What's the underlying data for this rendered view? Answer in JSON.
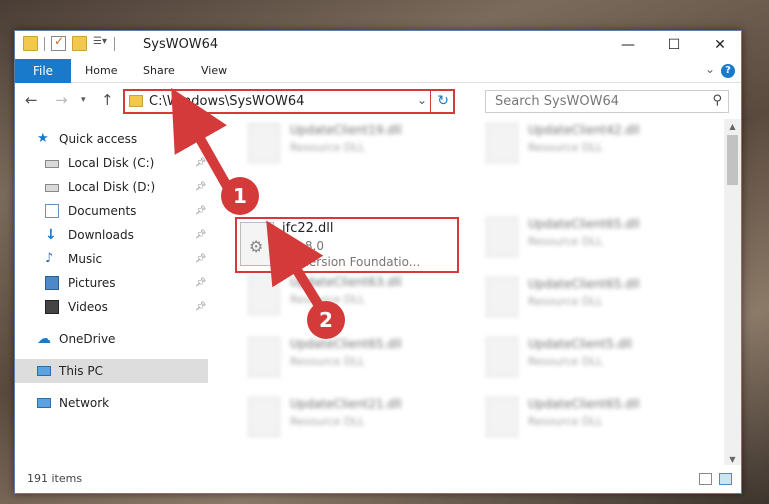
{
  "window": {
    "title": "SysWOW64",
    "minimize": "—",
    "maximize": "☐",
    "close": "✕"
  },
  "ribbon": {
    "file_label": "File",
    "tabs": [
      "Home",
      "Share",
      "View"
    ],
    "help": "?"
  },
  "navigation": {
    "back_icon": "back-arrow-icon",
    "forward_icon": "forward-arrow-icon",
    "recent_icon": "chevron-down-icon",
    "up_icon": "up-arrow-icon",
    "address_path": "C:\\Windows\\SysWOW64",
    "search_placeholder": "Search SysWOW64"
  },
  "sidebar": {
    "items": [
      {
        "label": "Quick access",
        "icon": "star-icon",
        "pinned": false
      },
      {
        "label": "Local Disk (C:)",
        "icon": "drive-icon",
        "pinned": true
      },
      {
        "label": "Local Disk (D:)",
        "icon": "drive-icon",
        "pinned": true
      },
      {
        "label": "Documents",
        "icon": "documents-icon",
        "pinned": true
      },
      {
        "label": "Downloads",
        "icon": "download-icon",
        "pinned": true
      },
      {
        "label": "Music",
        "icon": "music-icon",
        "pinned": true
      },
      {
        "label": "Pictures",
        "icon": "pictures-icon",
        "pinned": true
      },
      {
        "label": "Videos",
        "icon": "videos-icon",
        "pinned": true
      },
      {
        "label": "OneDrive",
        "icon": "cloud-icon",
        "pinned": false
      },
      {
        "label": "This PC",
        "icon": "computer-icon",
        "pinned": false,
        "selected": true
      },
      {
        "label": "Network",
        "icon": "network-icon",
        "pinned": false
      }
    ]
  },
  "files": {
    "left_column": [
      {
        "name": "UpdateClient19.dll",
        "type": "Resource DLL"
      },
      {
        "name": "ifc22.dll",
        "type": "2.2.8.0"
      },
      {
        "name": "UpdateClient63.dll",
        "type": "Resource DLL"
      },
      {
        "name": "UpdateClient65.dll",
        "type": "Resource DLL"
      },
      {
        "name": "UpdateClient21.dll",
        "type": "Resource DLL"
      }
    ],
    "right_column": [
      {
        "name": "UpdateClient42.dll",
        "type": "Resource DLL"
      },
      {
        "name": "UpdateClient65.dll",
        "type": "Resource DLL"
      },
      {
        "name": "UpdateClient65.dll",
        "type": "Resource DLL"
      },
      {
        "name": "UpdateClient5.dll",
        "type": "Resource DLL"
      },
      {
        "name": "UpdateClient65.dll",
        "type": "Resource DLL"
      }
    ],
    "highlighted": {
      "name": "ifc22.dll",
      "version": "2.2.8.0",
      "company": "Immersion Foundatio..."
    }
  },
  "status": {
    "item_count": "191 items"
  },
  "markers": {
    "step1": "1",
    "step2": "2"
  },
  "colors": {
    "accent": "#1979ca",
    "highlight": "#d43a3a"
  }
}
